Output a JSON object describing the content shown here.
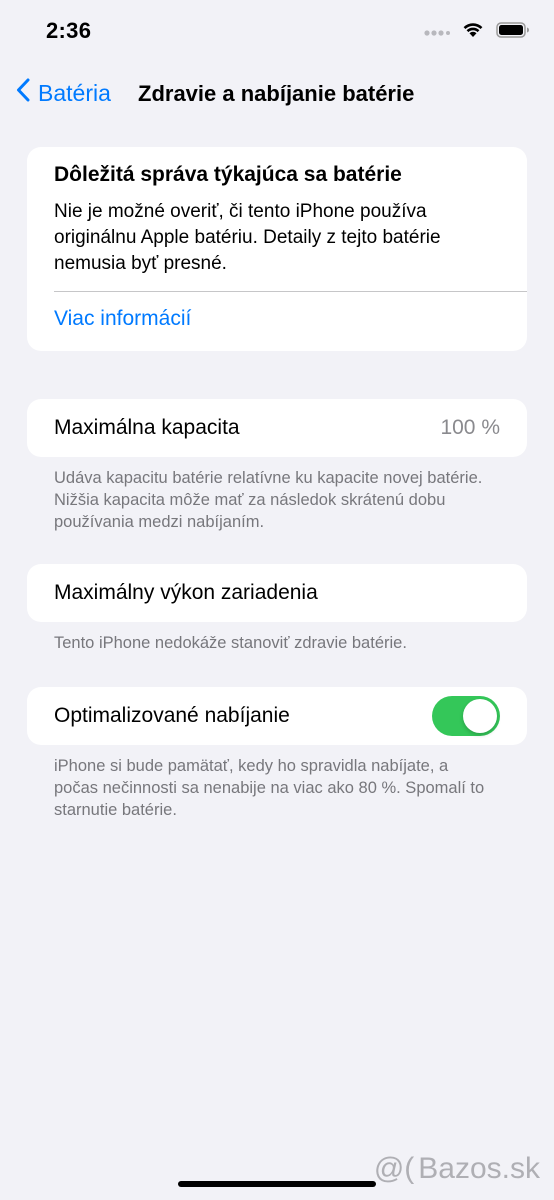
{
  "status_bar": {
    "time": "2:36",
    "icons": [
      "signal-dots-icon",
      "wifi-icon",
      "battery-icon"
    ]
  },
  "nav": {
    "back_label": "Batéria",
    "title": "Zdravie a nabíjanie batérie"
  },
  "important": {
    "title": "Dôležitá správa týkajúca sa batérie",
    "body": "Nie je možné overiť, či tento iPhone používa originálnu Apple batériu. Detaily z tejto batérie nemusia byť presné.",
    "link": "Viac informácií"
  },
  "max_capacity": {
    "label": "Maximálna kapacita",
    "value": "100 %",
    "footnote": "Udáva kapacitu batérie relatívne ku kapacite novej batérie. Nižšia kapacita môže mať za následok skrátenú dobu používania medzi nabíjaním."
  },
  "peak_performance": {
    "label": "Maximálny výkon zariadenia",
    "footnote": "Tento iPhone nedokáže stanoviť zdravie batérie."
  },
  "optimized_charging": {
    "label": "Optimalizované nabíjanie",
    "enabled": true,
    "footnote": "iPhone si bude pamätať, kedy ho spravidla nabíjate, a počas nečinnosti sa nenabije na viac ako 80 %. Spomalí to starnutie batérie."
  },
  "watermark": {
    "text": "Bazos.sk"
  },
  "colors": {
    "accent": "#007aff",
    "toggle_on": "#34c759",
    "background": "#f2f2f7"
  }
}
